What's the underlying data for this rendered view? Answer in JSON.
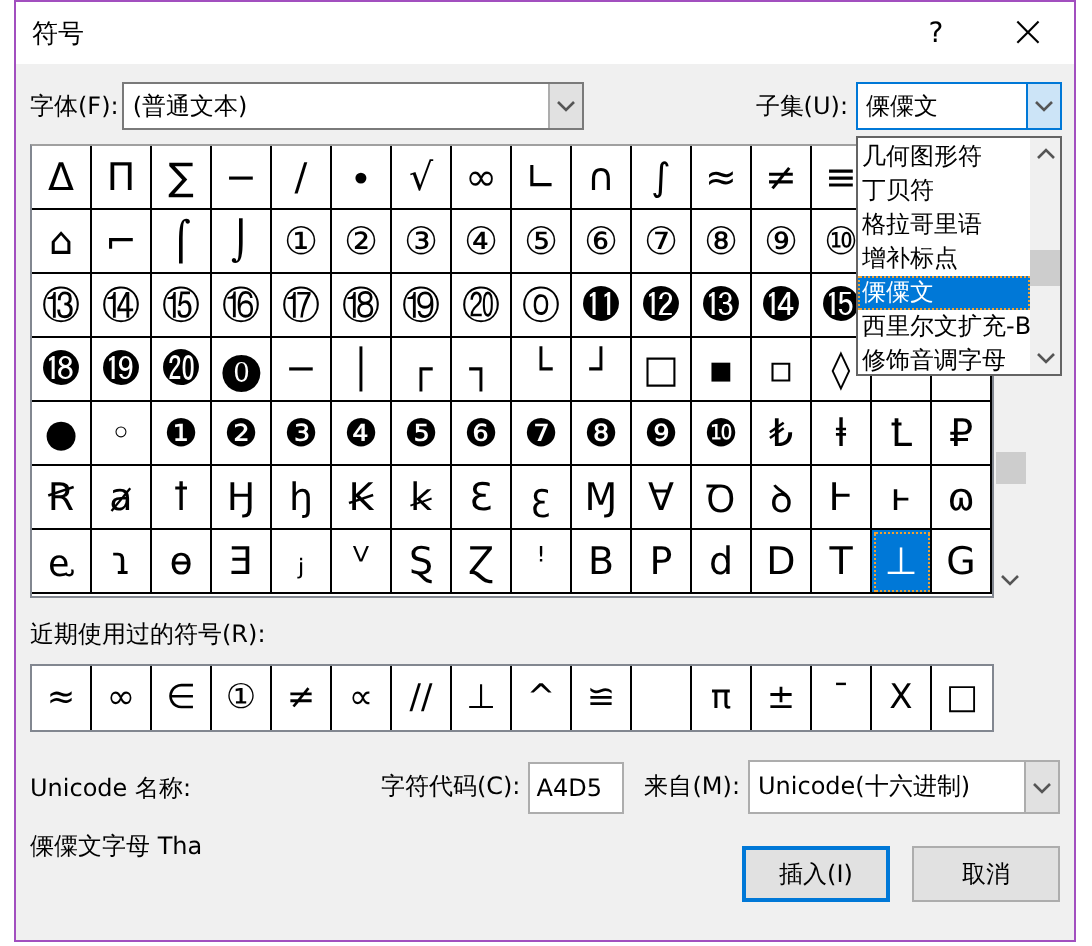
{
  "window": {
    "title": "符号",
    "help": "?",
    "close": "×"
  },
  "font": {
    "label": "字体(F):",
    "value": "(普通文本)"
  },
  "subset": {
    "label": "子集(U):",
    "value": "傈僳文",
    "expanded": true,
    "options": [
      {
        "label": "几何图形符",
        "selected": false
      },
      {
        "label": "丁贝符",
        "selected": false
      },
      {
        "label": "格拉哥里语",
        "selected": false
      },
      {
        "label": "增补标点",
        "selected": false
      },
      {
        "label": "傈僳文",
        "selected": true
      },
      {
        "label": "西里尔文扩充-B",
        "selected": false
      },
      {
        "label": "修饰音调字母",
        "selected": false
      }
    ]
  },
  "symbol_grid": {
    "rows": [
      [
        {
          "symbol": "Δ",
          "selected": false
        },
        {
          "symbol": "Π",
          "selected": false
        },
        {
          "symbol": "∑",
          "selected": false
        },
        {
          "symbol": "−",
          "selected": false
        },
        {
          "symbol": "∕",
          "selected": false
        },
        {
          "symbol": "∙",
          "selected": false
        },
        {
          "symbol": "√",
          "selected": false
        },
        {
          "symbol": "∞",
          "selected": false
        },
        {
          "symbol": "∟",
          "selected": false
        },
        {
          "symbol": "∩",
          "selected": false
        },
        {
          "symbol": "∫",
          "selected": false
        },
        {
          "symbol": "≈",
          "selected": false
        },
        {
          "symbol": "≠",
          "selected": false
        },
        {
          "symbol": "≡",
          "selected": false
        }
      ],
      [
        {
          "symbol": "⌂",
          "selected": false
        },
        {
          "symbol": "⌐",
          "selected": false
        },
        {
          "symbol": "⌠",
          "selected": false
        },
        {
          "symbol": "⌡",
          "selected": false
        },
        {
          "symbol": "①",
          "selected": false
        },
        {
          "symbol": "②",
          "selected": false
        },
        {
          "symbol": "③",
          "selected": false
        },
        {
          "symbol": "④",
          "selected": false
        },
        {
          "symbol": "⑤",
          "selected": false
        },
        {
          "symbol": "⑥",
          "selected": false
        },
        {
          "symbol": "⑦",
          "selected": false
        },
        {
          "symbol": "⑧",
          "selected": false
        },
        {
          "symbol": "⑨",
          "selected": false
        },
        {
          "symbol": "⑩",
          "selected": false
        }
      ],
      [
        {
          "symbol": "⑬",
          "selected": false
        },
        {
          "symbol": "⑭",
          "selected": false
        },
        {
          "symbol": "⑮",
          "selected": false
        },
        {
          "symbol": "⑯",
          "selected": false
        },
        {
          "symbol": "⑰",
          "selected": false
        },
        {
          "symbol": "⑱",
          "selected": false
        },
        {
          "symbol": "⑲",
          "selected": false
        },
        {
          "symbol": "⑳",
          "selected": false
        },
        {
          "symbol": "⓪",
          "selected": false
        },
        {
          "symbol": "⓫",
          "selected": false
        },
        {
          "symbol": "⓬",
          "selected": false
        },
        {
          "symbol": "⓭",
          "selected": false
        },
        {
          "symbol": "⓮",
          "selected": false
        },
        {
          "symbol": "⓯",
          "selected": false
        }
      ],
      [
        {
          "symbol": "⓲",
          "selected": false
        },
        {
          "symbol": "⓳",
          "selected": false
        },
        {
          "symbol": "⓴",
          "selected": false
        },
        {
          "symbol": "⓿",
          "selected": false
        },
        {
          "symbol": "─",
          "selected": false
        },
        {
          "symbol": "│",
          "selected": false
        },
        {
          "symbol": "┌",
          "selected": false
        },
        {
          "symbol": "┐",
          "selected": false
        },
        {
          "symbol": "└",
          "selected": false
        },
        {
          "symbol": "┘",
          "selected": false
        },
        {
          "symbol": "□",
          "selected": false
        },
        {
          "symbol": "▪",
          "selected": false
        },
        {
          "symbol": "▫",
          "selected": false
        },
        {
          "symbol": "◊",
          "selected": false
        }
      ],
      [
        {
          "symbol": "●",
          "selected": false
        },
        {
          "symbol": "◦",
          "selected": false
        },
        {
          "symbol": "❶",
          "selected": false
        },
        {
          "symbol": "❷",
          "selected": false
        },
        {
          "symbol": "❸",
          "selected": false
        },
        {
          "symbol": "❹",
          "selected": false
        },
        {
          "symbol": "❺",
          "selected": false
        },
        {
          "symbol": "❻",
          "selected": false
        },
        {
          "symbol": "❼",
          "selected": false
        },
        {
          "symbol": "❽",
          "selected": false
        },
        {
          "symbol": "❾",
          "selected": false
        },
        {
          "symbol": "❿",
          "selected": false
        },
        {
          "symbol": "₺",
          "selected": false
        },
        {
          "symbol": "ⱡ",
          "selected": false
        },
        {
          "symbol": "Ꝉ",
          "selected": false
        },
        {
          "symbol": "₽",
          "selected": false
        }
      ],
      [
        {
          "symbol": "Ꞧ",
          "selected": false
        },
        {
          "symbol": "ⱥ",
          "selected": false
        },
        {
          "symbol": "ꝉ",
          "selected": false
        },
        {
          "symbol": "Ꜧ",
          "selected": false
        },
        {
          "symbol": "ꜧ",
          "selected": false
        },
        {
          "symbol": "Ꞣ",
          "selected": false
        },
        {
          "symbol": "ꞣ",
          "selected": false
        },
        {
          "symbol": "Ꜫ",
          "selected": false
        },
        {
          "symbol": "ꜫ",
          "selected": false
        },
        {
          "symbol": "Ɱ",
          "selected": false
        },
        {
          "symbol": "Ɐ",
          "selected": false
        },
        {
          "symbol": "Ꝺ",
          "selected": false
        },
        {
          "symbol": "ꝺ",
          "selected": false
        },
        {
          "symbol": "Ⱶ",
          "selected": false
        },
        {
          "symbol": "ⱶ",
          "selected": false
        },
        {
          "symbol": "ɷ",
          "selected": false
        }
      ],
      [
        {
          "symbol": "ⱸ",
          "selected": false
        },
        {
          "symbol": "ɿ",
          "selected": false
        },
        {
          "symbol": "ɵ",
          "selected": false
        },
        {
          "symbol": "Ǝ",
          "selected": false
        },
        {
          "symbol": "ⱼ",
          "selected": false
        },
        {
          "symbol": "ⱽ",
          "selected": false
        },
        {
          "symbol": "Ȿ",
          "selected": false
        },
        {
          "symbol": "Ɀ",
          "selected": false
        },
        {
          "symbol": "ꜝ",
          "selected": false
        },
        {
          "symbol": "B",
          "selected": false
        },
        {
          "symbol": "P",
          "selected": false
        },
        {
          "symbol": "d",
          "selected": false
        },
        {
          "symbol": "D",
          "selected": false
        },
        {
          "symbol": "T",
          "selected": false
        },
        {
          "symbol": "⊥",
          "selected": true
        },
        {
          "symbol": "G",
          "selected": false
        }
      ]
    ]
  },
  "recent": {
    "label": "近期使用过的符号(R):",
    "symbols": [
      {
        "kind": "symbol",
        "symbol": "≈"
      },
      {
        "kind": "symbol",
        "symbol": "∞"
      },
      {
        "kind": "symbol",
        "symbol": "∈"
      },
      {
        "kind": "symbol",
        "symbol": "①"
      },
      {
        "kind": "symbol",
        "symbol": "≠"
      },
      {
        "kind": "symbol",
        "symbol": "∝"
      },
      {
        "kind": "symbol",
        "symbol": "//"
      },
      {
        "kind": "symbol",
        "symbol": "⊥"
      },
      {
        "kind": "symbol",
        "symbol": "^"
      },
      {
        "kind": "symbol",
        "symbol": "≌"
      },
      {
        "kind": "blank"
      },
      {
        "kind": "symbol",
        "symbol": "π"
      },
      {
        "kind": "symbol",
        "symbol": "±"
      },
      {
        "kind": "symbol",
        "symbol": "¯"
      },
      {
        "kind": "symbol",
        "symbol": "Χ"
      },
      {
        "kind": "symbol",
        "symbol": "□"
      }
    ]
  },
  "unicode_name": {
    "label": "Unicode 名称:",
    "value": "傈僳文字母 Tha"
  },
  "char_code": {
    "label": "字符代码(C):",
    "value": "A4D5"
  },
  "from": {
    "label": "来自(M):",
    "value": "Unicode(十六进制)"
  },
  "buttons": [
    {
      "label": "插入(I)",
      "default": true
    },
    {
      "label": "取消",
      "default": false
    }
  ]
}
